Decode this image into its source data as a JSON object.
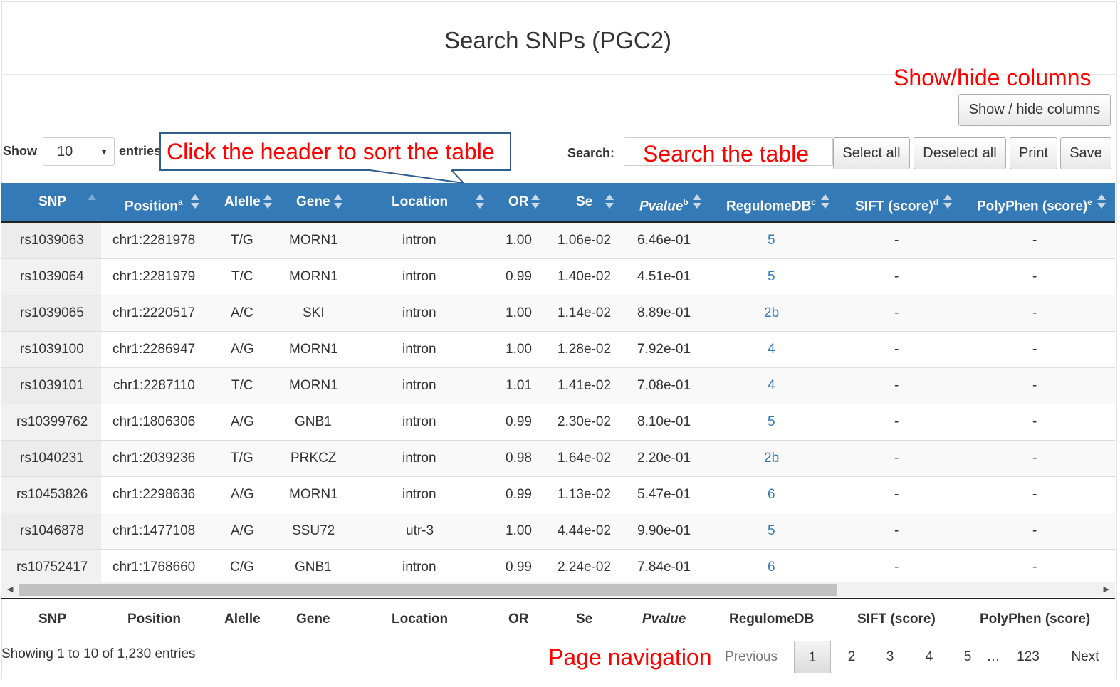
{
  "title": "Search SNPs (PGC2)",
  "annotations": {
    "show_hide": "Show/hide columns",
    "sort": "Click the header to sort the table",
    "search": "Search the table",
    "page": "Page navigation"
  },
  "toolbar": {
    "show_hide_columns": "Show / hide columns",
    "show_label": "Show",
    "entries_value": "10",
    "entries_label": "entries",
    "search_label": "Search:",
    "search_value": "",
    "select_all": "Select all",
    "deselect_all": "Deselect all",
    "print": "Print",
    "save": "Save"
  },
  "table": {
    "columns": [
      {
        "key": "snp",
        "label": "SNP",
        "sup": "",
        "sort": "asc"
      },
      {
        "key": "position",
        "label": "Position",
        "sup": "a",
        "sort": "both"
      },
      {
        "key": "allele",
        "label": "Alelle",
        "sup": "",
        "sort": "both"
      },
      {
        "key": "gene",
        "label": "Gene",
        "sup": "",
        "sort": "both"
      },
      {
        "key": "location",
        "label": "Location",
        "sup": "",
        "sort": "both"
      },
      {
        "key": "or",
        "label": "OR",
        "sup": "",
        "sort": "both"
      },
      {
        "key": "se",
        "label": "Se",
        "sup": "",
        "sort": "both"
      },
      {
        "key": "pvalue",
        "label": "Pvalue",
        "sup": "b",
        "sort": "both"
      },
      {
        "key": "regulome",
        "label": "RegulomeDB",
        "sup": "c",
        "sort": "both"
      },
      {
        "key": "sift",
        "label": "SIFT (score)",
        "sup": "d",
        "sort": "both"
      },
      {
        "key": "polyphen",
        "label": "PolyPhen (score)",
        "sup": "e",
        "sort": "both"
      }
    ],
    "footer": [
      "SNP",
      "Position",
      "Alelle",
      "Gene",
      "Location",
      "OR",
      "Se",
      "Pvalue",
      "RegulomeDB",
      "SIFT (score)",
      "PolyPhen (score)"
    ],
    "rows": [
      [
        "rs1039063",
        "chr1:2281978",
        "T/G",
        "MORN1",
        "intron",
        "1.00",
        "1.06e-02",
        "6.46e-01",
        "5",
        "-",
        "-"
      ],
      [
        "rs1039064",
        "chr1:2281979",
        "T/C",
        "MORN1",
        "intron",
        "0.99",
        "1.40e-02",
        "4.51e-01",
        "5",
        "-",
        "-"
      ],
      [
        "rs1039065",
        "chr1:2220517",
        "A/C",
        "SKI",
        "intron",
        "1.00",
        "1.14e-02",
        "8.89e-01",
        "2b",
        "-",
        "-"
      ],
      [
        "rs1039100",
        "chr1:2286947",
        "A/G",
        "MORN1",
        "intron",
        "1.00",
        "1.28e-02",
        "7.92e-01",
        "4",
        "-",
        "-"
      ],
      [
        "rs1039101",
        "chr1:2287110",
        "T/C",
        "MORN1",
        "intron",
        "1.01",
        "1.41e-02",
        "7.08e-01",
        "4",
        "-",
        "-"
      ],
      [
        "rs10399762",
        "chr1:1806306",
        "A/G",
        "GNB1",
        "intron",
        "0.99",
        "2.30e-02",
        "8.10e-01",
        "5",
        "-",
        "-"
      ],
      [
        "rs1040231",
        "chr1:2039236",
        "T/G",
        "PRKCZ",
        "intron",
        "0.98",
        "1.64e-02",
        "2.20e-01",
        "2b",
        "-",
        "-"
      ],
      [
        "rs10453826",
        "chr1:2298636",
        "A/G",
        "MORN1",
        "intron",
        "0.99",
        "1.13e-02",
        "5.47e-01",
        "6",
        "-",
        "-"
      ],
      [
        "rs1046878",
        "chr1:1477108",
        "A/G",
        "SSU72",
        "utr-3",
        "1.00",
        "4.44e-02",
        "9.90e-01",
        "5",
        "-",
        "-"
      ],
      [
        "rs10752417",
        "chr1:1768660",
        "C/G",
        "GNB1",
        "intron",
        "0.99",
        "2.24e-02",
        "7.84e-01",
        "6",
        "-",
        "-"
      ]
    ]
  },
  "info": "Showing 1 to 10 of 1,230 entries",
  "pagination": {
    "previous": "Previous",
    "pages": [
      "1",
      "2",
      "3",
      "4",
      "5"
    ],
    "ellipsis": "…",
    "last": "123",
    "next": "Next",
    "current": "1"
  },
  "colors": {
    "header_bg": "#337ab7",
    "annotation": "#ff0000",
    "link": "#337ab7"
  }
}
